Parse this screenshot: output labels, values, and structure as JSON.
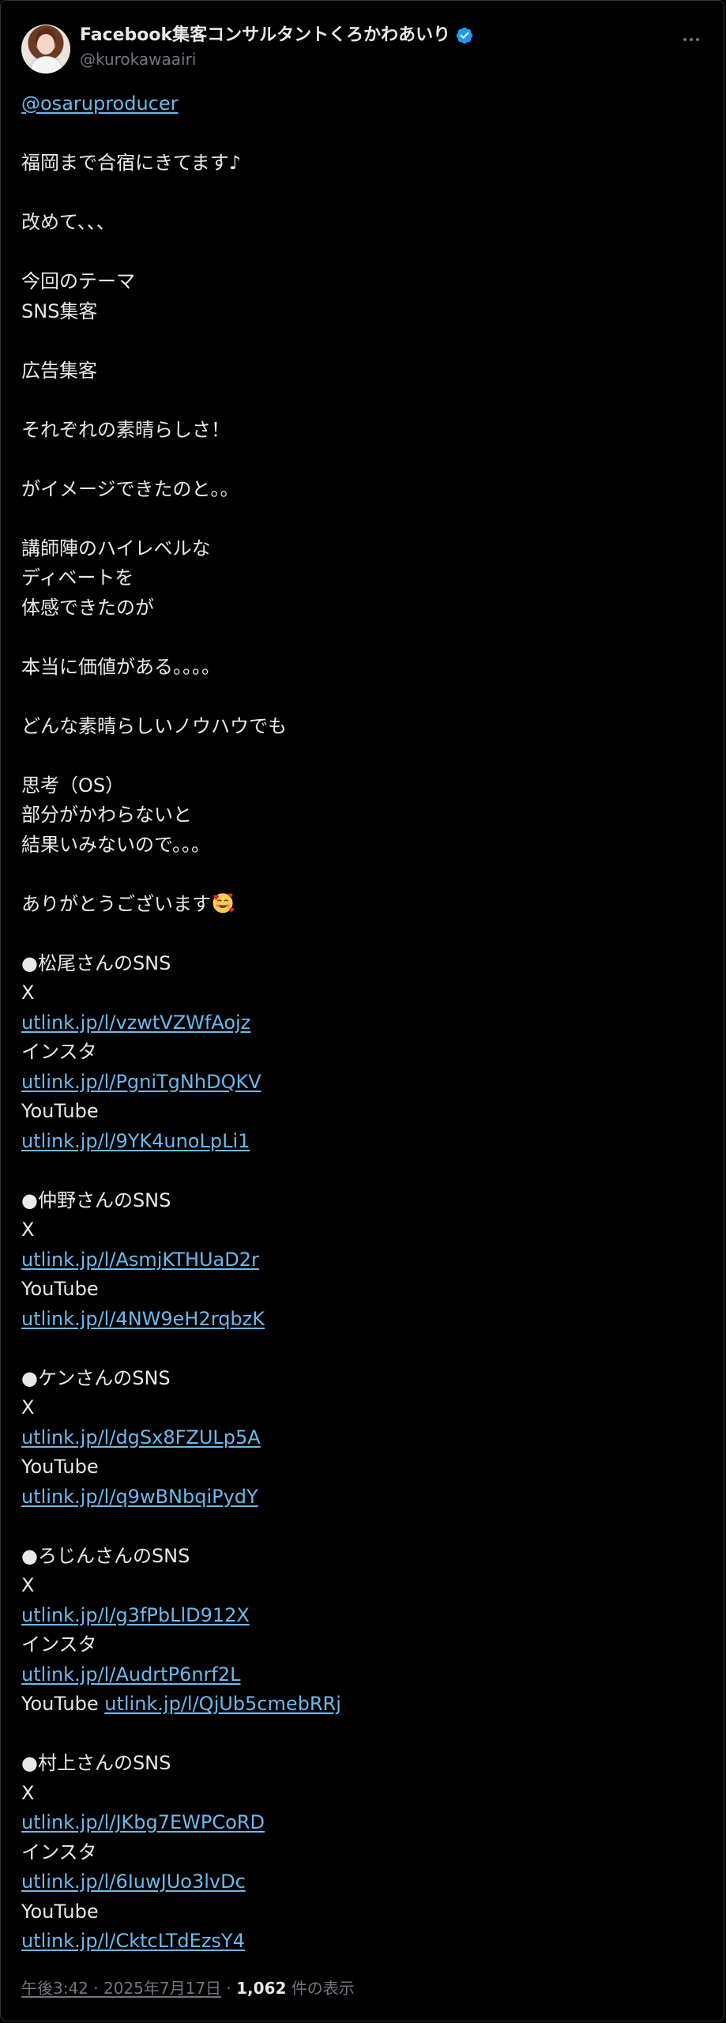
{
  "author": {
    "display_name": "Facebook集客コンサルタントくろかわあいり",
    "handle": "@kurokawaairi"
  },
  "tweet": {
    "mention": "@osaruproducer",
    "blocks": [
      [
        "福岡まで合宿にきてます♪"
      ],
      [
        "改めて、、、"
      ],
      [
        "今回のテーマ",
        "SNS集客"
      ],
      [
        "広告集客"
      ],
      [
        "それぞれの素晴らしさ！"
      ],
      [
        "がイメージできたのと。。"
      ],
      [
        "講師陣のハイレベルな",
        "ディベートを",
        "体感できたのが"
      ],
      [
        "本当に価値がある。。。。"
      ],
      [
        "どんな素晴らしいノウハウでも"
      ],
      [
        "思考（OS）",
        "部分がかわらないと",
        "結果いみないので。。。"
      ]
    ],
    "thanks": "ありがとうございます",
    "thanks_emoji": "smiling-face-with-hearts-icon",
    "sections": [
      {
        "heading": "●松尾さんのSNS",
        "entries": [
          {
            "label": "X",
            "link": "utlink.jp/l/vzwtVZWfAojz"
          },
          {
            "label": "インスタ",
            "link": "utlink.jp/l/PgniTgNhDQKV"
          },
          {
            "label": "YouTube",
            "link": "utlink.jp/l/9YK4unoLpLi1"
          }
        ]
      },
      {
        "heading": "●仲野さんのSNS",
        "entries": [
          {
            "label": "X",
            "link": "utlink.jp/l/AsmjKTHUaD2r"
          },
          {
            "label": "YouTube",
            "link": "utlink.jp/l/4NW9eH2rqbzK"
          }
        ]
      },
      {
        "heading": "●ケンさんのSNS",
        "entries": [
          {
            "label": "X",
            "link": "utlink.jp/l/dgSx8FZULp5A"
          },
          {
            "label": "YouTube",
            "link": "utlink.jp/l/q9wBNbqiPydY"
          }
        ]
      },
      {
        "heading": "●ろじんさんのSNS",
        "entries": [
          {
            "label": "X",
            "link": "utlink.jp/l/g3fPbLlD912X"
          },
          {
            "label": "インスタ",
            "link": "utlink.jp/l/AudrtP6nrf2L"
          },
          {
            "label": "YouTube",
            "link": "utlink.jp/l/QjUb5cmebRRj",
            "inline": true
          }
        ]
      },
      {
        "heading": "●村上さんのSNS",
        "entries": [
          {
            "label": "X",
            "link": "utlink.jp/l/JKbg7EWPCoRD"
          },
          {
            "label": "インスタ",
            "link": "utlink.jp/l/6IuwJUo3lvDc"
          },
          {
            "label": "YouTube",
            "link": "utlink.jp/l/CktcLTdEzsY4"
          }
        ]
      }
    ]
  },
  "footer": {
    "timestamp": "午後3:42 · 2025年7月17日",
    "separator": " · ",
    "views_count": "1,062",
    "views_label": " 件の表示"
  },
  "colors": {
    "background": "#000000",
    "text": "#e7e9ea",
    "secondary": "#71767b",
    "link": "#6cb9ec",
    "verified": "#1d9bf0"
  }
}
